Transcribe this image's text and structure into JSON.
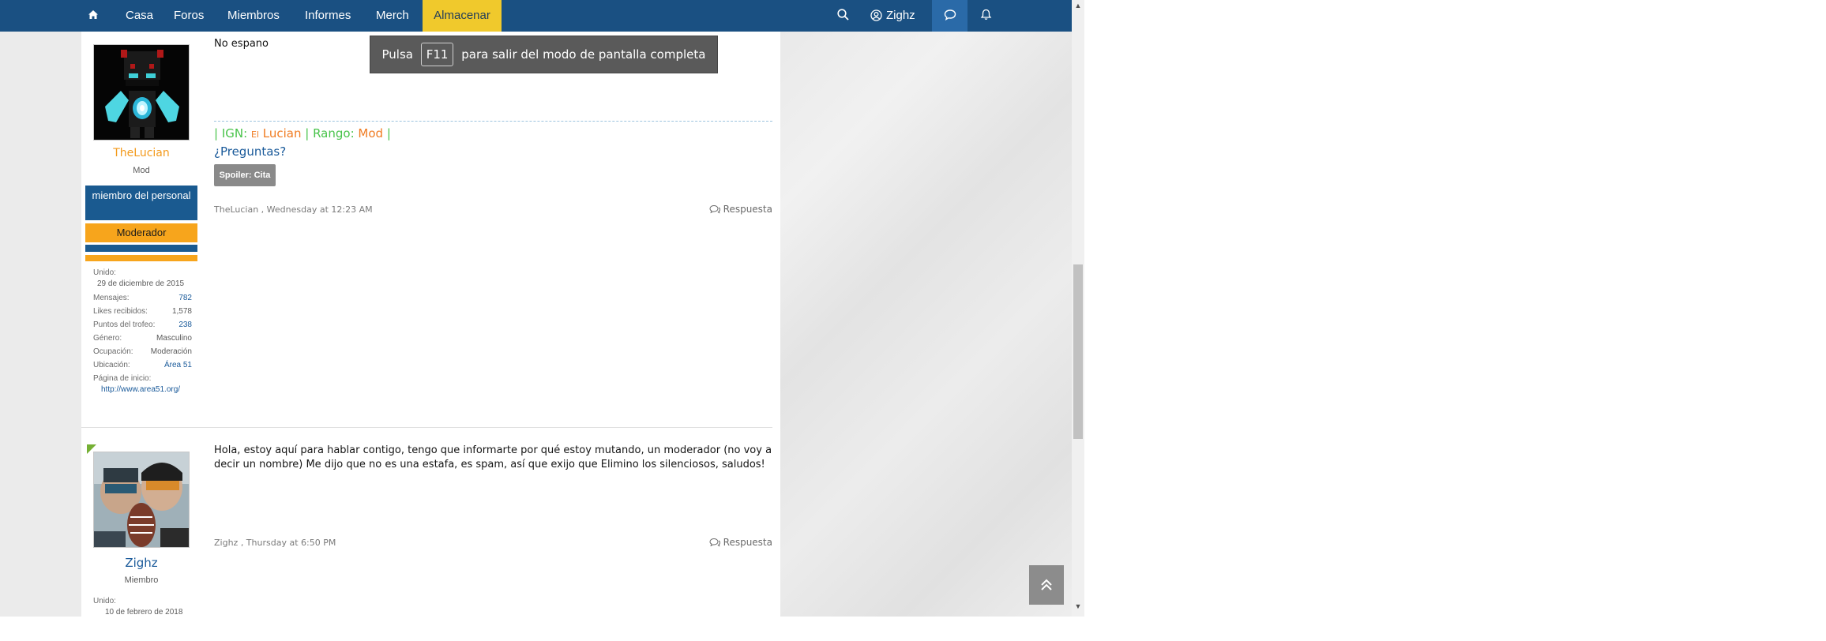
{
  "nav": {
    "home_icon": "home-icon",
    "items": [
      "Casa",
      "Foros",
      "Miembros",
      "Informes",
      "Merch"
    ],
    "active_item": "Almacenar",
    "search_icon": "search-icon",
    "user_label": "Zighz",
    "chat_icon": "chat-icon",
    "bell_icon": "bell-icon",
    "accent_color": "#f0c92c",
    "bar_color": "#1a5082"
  },
  "toast": {
    "prefix": "Pulsa",
    "key": "F11",
    "suffix": "para salir del modo de pantalla completa"
  },
  "posts": [
    {
      "username": "TheLucian",
      "user_title": "Mod",
      "banners": [
        "miembro del personal",
        "Moderador"
      ],
      "info": [
        {
          "label": "Unido:",
          "value": "29 de diciembre de 2015"
        },
        {
          "label": "Mensajes:",
          "value": "782"
        },
        {
          "label": "Likes recibidos:",
          "value": "1,578"
        },
        {
          "label": "Puntos del trofeo:",
          "value": "238"
        },
        {
          "label": "Género:",
          "value": "Masculino"
        },
        {
          "label": "Ocupación:",
          "value": "Moderación"
        },
        {
          "label": "Ubicación:",
          "value": "Área 51"
        },
        {
          "label": "Página de inicio:",
          "value": "http://www.area51.org/"
        }
      ],
      "text": "No espano",
      "signature": {
        "sep1": "|",
        "ign_label": "IGN:",
        "ign_prefix": "El",
        "ign_value": "Lucian",
        "sep2": "|",
        "rank_label": "Rango:",
        "rank_value": "Mod",
        "sep3": "|",
        "question": "¿Preguntas?",
        "spoiler": "Spoiler: Cita"
      },
      "meta": "TheLucian , Wednesday at 12:23 AM",
      "reply": "Respuesta"
    },
    {
      "username": "Zighz",
      "user_title": "Miembro",
      "info": [
        {
          "label": "Unido:",
          "value": "10 de febrero de 2018"
        }
      ],
      "text": "Hola, estoy aquí para hablar contigo, tengo que informarte por qué estoy mutando, un moderador (no voy a decir un nombre) Me dijo que no es una estafa, es spam, así que exijo que Elimino los silenciosos, saludos!",
      "meta": "Zighz , Thursday at 6:50 PM",
      "reply": "Respuesta"
    }
  ],
  "back_to_top_icon": "double-chevron-up-icon"
}
